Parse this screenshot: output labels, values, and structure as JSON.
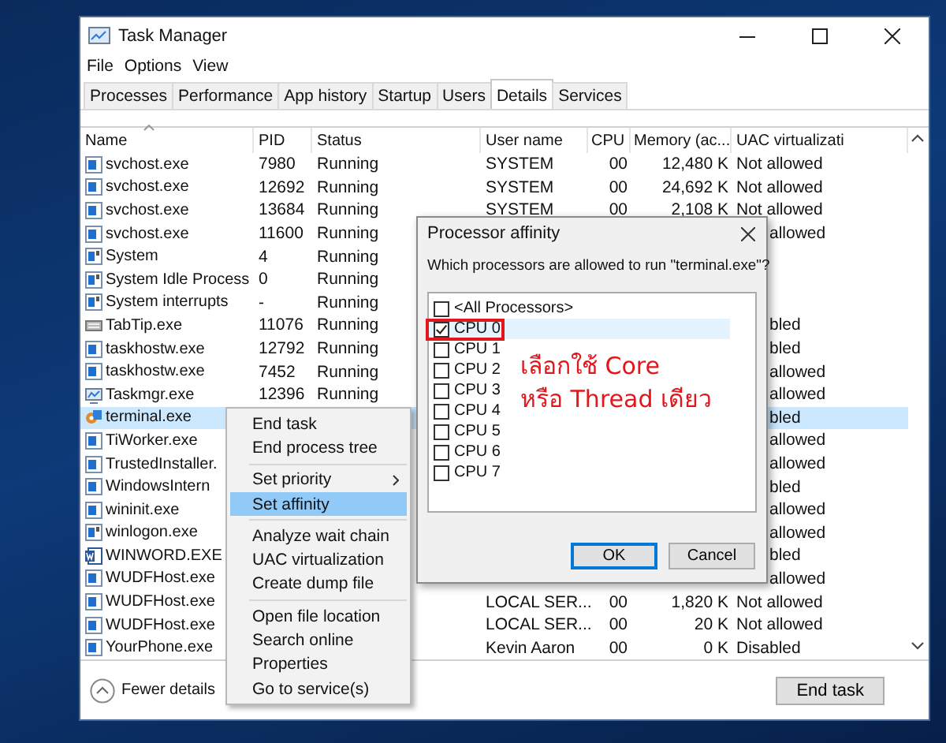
{
  "window": {
    "title": "Task Manager"
  },
  "menu_bar": [
    "File",
    "Options",
    "View"
  ],
  "tabs": [
    {
      "label": "Processes",
      "selected": false
    },
    {
      "label": "Performance",
      "selected": false
    },
    {
      "label": "App history",
      "selected": false
    },
    {
      "label": "Startup",
      "selected": false
    },
    {
      "label": "Users",
      "selected": false
    },
    {
      "label": "Details",
      "selected": true
    },
    {
      "label": "Services",
      "selected": false
    }
  ],
  "table": {
    "columns": [
      "Name",
      "PID",
      "Status",
      "User name",
      "CPU",
      "Memory (ac...",
      "UAC virtualizati"
    ],
    "rows": [
      {
        "kind": "window",
        "name": "svchost.exe",
        "pid": "7980",
        "status": "Running",
        "user": "SYSTEM",
        "cpu": "00",
        "memory": "12,480 K",
        "uac": "Not allowed",
        "selected": false
      },
      {
        "kind": "window",
        "name": "svchost.exe",
        "pid": "12692",
        "status": "Running",
        "user": "SYSTEM",
        "cpu": "00",
        "memory": "24,692 K",
        "uac": "Not allowed",
        "selected": false
      },
      {
        "kind": "window",
        "name": "svchost.exe",
        "pid": "13684",
        "status": "Running",
        "user": "SYSTEM",
        "cpu": "00",
        "memory": "2,108 K",
        "uac": "Not allowed",
        "selected": false
      },
      {
        "kind": "window",
        "name": "svchost.exe",
        "pid": "11600",
        "status": "Running",
        "uac": "allowed",
        "selected": false
      },
      {
        "kind": "system",
        "name": "System",
        "pid": "4",
        "status": "Running",
        "selected": false
      },
      {
        "kind": "system",
        "name": "System Idle Process",
        "pid": "0",
        "status": "Running",
        "selected": false
      },
      {
        "kind": "system",
        "name": "System interrupts",
        "pid": "-",
        "status": "Running",
        "selected": false
      },
      {
        "kind": "keyboard",
        "name": "TabTip.exe",
        "pid": "11076",
        "status": "Running",
        "uac": "bled",
        "selected": false
      },
      {
        "kind": "window",
        "name": "taskhostw.exe",
        "pid": "12792",
        "status": "Running",
        "uac": "bled",
        "selected": false
      },
      {
        "kind": "window",
        "name": "taskhostw.exe",
        "pid": "7452",
        "status": "Running",
        "uac": "allowed",
        "selected": false
      },
      {
        "kind": "monitor",
        "name": "Taskmgr.exe",
        "pid": "12396",
        "status": "Running",
        "uac": "allowed",
        "selected": false
      },
      {
        "kind": "terminal",
        "name": "terminal.exe",
        "uac": "bled",
        "selected": true
      },
      {
        "kind": "window",
        "name": "TiWorker.exe",
        "uac": "allowed",
        "selected": false
      },
      {
        "kind": "window",
        "name": "TrustedInstaller.",
        "uac": "allowed",
        "selected": false
      },
      {
        "kind": "window",
        "name": "WindowsIntern",
        "uac": "bled",
        "selected": false
      },
      {
        "kind": "window",
        "name": "wininit.exe",
        "uac": "allowed",
        "selected": false
      },
      {
        "kind": "system",
        "name": "winlogon.exe",
        "uac": "allowed",
        "selected": false
      },
      {
        "kind": "document",
        "name": "WINWORD.EXE",
        "uac": "bled",
        "selected": false
      },
      {
        "kind": "window",
        "name": "WUDFHost.exe",
        "uac": "allowed",
        "selected": false
      },
      {
        "kind": "window",
        "name": "WUDFHost.exe",
        "user": "LOCAL SER...",
        "cpu": "00",
        "memory": "1,820 K",
        "uac": "Not allowed",
        "selected": false
      },
      {
        "kind": "window",
        "name": "WUDFHost.exe",
        "user": "LOCAL SER...",
        "cpu": "00",
        "memory": "20 K",
        "uac": "Not allowed",
        "selected": false
      },
      {
        "kind": "window",
        "name": "YourPhone.exe",
        "user": "Kevin Aaron",
        "cpu": "00",
        "memory": "0 K",
        "uac": "Disabled",
        "selected": false
      }
    ]
  },
  "footer": {
    "details_toggle": "Fewer details",
    "button": "End task"
  },
  "context_menu": {
    "groups": [
      [
        {
          "label": "End task",
          "selected": false,
          "submenu": false
        },
        {
          "label": "End process tree",
          "selected": false,
          "submenu": false
        }
      ],
      [
        {
          "label": "Set priority",
          "selected": false,
          "submenu": true
        },
        {
          "label": "Set affinity",
          "selected": true,
          "submenu": false
        }
      ],
      [
        {
          "label": "Analyze wait chain",
          "selected": false,
          "submenu": false
        },
        {
          "label": "UAC virtualization",
          "selected": false,
          "submenu": false
        },
        {
          "label": "Create dump file",
          "selected": false,
          "submenu": false
        }
      ],
      [
        {
          "label": "Open file location",
          "selected": false,
          "submenu": false
        },
        {
          "label": "Search online",
          "selected": false,
          "submenu": false
        },
        {
          "label": "Properties",
          "selected": false,
          "submenu": false
        },
        {
          "label": "Go to service(s)",
          "selected": false,
          "submenu": false
        }
      ]
    ]
  },
  "dialog": {
    "title": "Processor affinity",
    "question": "Which processors are allowed to run \"terminal.exe\"?",
    "processors": [
      {
        "label": "<All Processors>",
        "checked": false,
        "selected": false,
        "marked": false
      },
      {
        "label": "CPU 0",
        "checked": true,
        "selected": true,
        "marked": true
      },
      {
        "label": "CPU 1",
        "checked": false,
        "selected": false,
        "marked": false
      },
      {
        "label": "CPU 2",
        "checked": false,
        "selected": false,
        "marked": false
      },
      {
        "label": "CPU 3",
        "checked": false,
        "selected": false,
        "marked": false
      },
      {
        "label": "CPU 4",
        "checked": false,
        "selected": false,
        "marked": false
      },
      {
        "label": "CPU 5",
        "checked": false,
        "selected": false,
        "marked": false
      },
      {
        "label": "CPU 6",
        "checked": false,
        "selected": false,
        "marked": false
      },
      {
        "label": "CPU 7",
        "checked": false,
        "selected": false,
        "marked": false
      }
    ],
    "note": [
      "เลือกใช้ Core",
      "หรือ Thread เดียว"
    ],
    "buttons": [
      {
        "label": "OK",
        "default": true
      },
      {
        "label": "Cancel",
        "default": false
      }
    ]
  }
}
